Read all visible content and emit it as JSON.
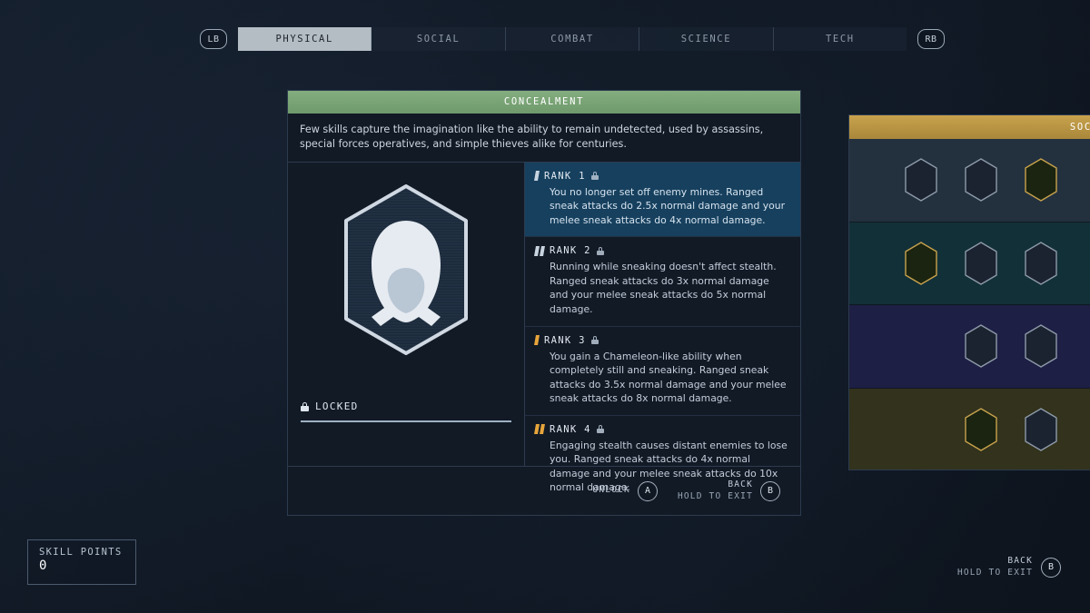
{
  "topbar": {
    "left_shoulder": "LB",
    "right_shoulder": "RB",
    "tabs": [
      {
        "label": "PHYSICAL",
        "active": true
      },
      {
        "label": "SOCIAL",
        "active": false
      },
      {
        "label": "COMBAT",
        "active": false
      },
      {
        "label": "SCIENCE",
        "active": false
      },
      {
        "label": "TECH",
        "active": false
      }
    ]
  },
  "detail": {
    "title": "CONCEALMENT",
    "description": "Few skills capture the imagination like the ability to remain undetected, used by assassins, special forces operatives, and simple thieves alike for centuries.",
    "status": "LOCKED",
    "icon_name": "hooded-figure-badge-icon",
    "ranks": [
      {
        "title": "RANK 1",
        "pips": 1,
        "pip_color": "#c8d4e0",
        "locked": true,
        "selected": true,
        "text": "You no longer set off enemy mines. Ranged sneak attacks do 2.5x normal damage and your melee sneak attacks do 4x normal damage."
      },
      {
        "title": "RANK 2",
        "pips": 2,
        "pip_color": "#c8d4e0",
        "locked": true,
        "selected": false,
        "text": "Running while sneaking doesn't affect stealth. Ranged sneak attacks do 3x normal damage and your melee sneak attacks do 5x normal damage."
      },
      {
        "title": "RANK 3",
        "pips": 1,
        "pip_color": "#e8a53a",
        "locked": true,
        "selected": false,
        "text": "You gain a Chameleon-like ability when completely still and sneaking. Ranged sneak attacks do 3.5x normal damage and your melee sneak attacks do 8x normal damage."
      },
      {
        "title": "RANK 4",
        "pips": 2,
        "pip_color": "#e8a53a",
        "locked": true,
        "selected": false,
        "text": "Engaging stealth causes distant enemies to lose you. Ranged sneak attacks do 4x normal damage and your melee sneak attacks do 10x normal damage."
      }
    ],
    "footer": {
      "unlock_label": "UNLOCK",
      "unlock_button": "A",
      "back_label": "BACK",
      "back_hint": "HOLD TO EXIT",
      "back_button": "B"
    }
  },
  "social_panel": {
    "title": "SOCIAL",
    "header_color": "#c8a24c",
    "rows": [
      {
        "band_color": "#23313f",
        "skills": [
          "hush-finger-icon",
          "boot-step-icon",
          "green-burst-icon"
        ]
      },
      {
        "band_color": "#123038",
        "skills": [
          "money-bag-gift-icon",
          "crowd-icon",
          "speech-icon"
        ]
      },
      {
        "band_color": "#1e1f45",
        "skills": [
          "",
          "arrows-up-icon",
          "figure-icon"
        ]
      },
      {
        "band_color": "#32321d",
        "skills": [
          "",
          "puppet-strings-icon",
          "mask-icon"
        ]
      }
    ]
  },
  "skill_points": {
    "label": "SKILL POINTS",
    "value": "0"
  },
  "exit_prompt": {
    "back_label": "BACK",
    "back_hint": "HOLD TO EXIT",
    "back_button": "B"
  }
}
